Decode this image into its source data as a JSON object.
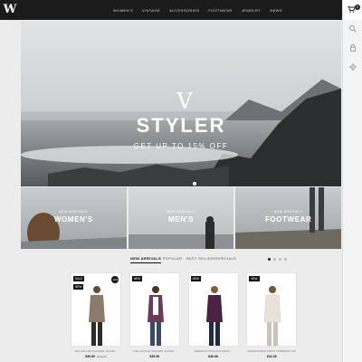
{
  "brand": {
    "logo_text": "W"
  },
  "nav": {
    "items": [
      "Women's",
      "Vintage",
      "Accessories",
      "Footwear",
      "Jewelry",
      "News"
    ]
  },
  "sidebar": {
    "cart_count": "0",
    "icons": [
      "cart-icon",
      "search-icon",
      "user-icon",
      "gear-icon"
    ]
  },
  "hero": {
    "mark": "V",
    "title": "STYLER",
    "subtitle": "GET UP TO 15% OFF"
  },
  "categories": [
    {
      "kicker": "NEW ARRIVALS",
      "label": "WOMEN'S"
    },
    {
      "kicker": "NEW ARRIVALS",
      "label": "MEN'S"
    },
    {
      "kicker": "NEW ARRIVALS",
      "label": "FOOTWEAR"
    }
  ],
  "tabs": [
    "New Arrivals",
    "Popular",
    "Best Sellers",
    "Specials"
  ],
  "pager": {
    "active": 1,
    "count": 4
  },
  "products": [
    {
      "badge_new": "NEW",
      "badge_sale": "SALE",
      "badge_pct": "-10%",
      "name": "TAN COLLAR LEATHER JACKET...",
      "price": "$39.80",
      "old_price": "$44.00",
      "color": "#8a7a6a"
    },
    {
      "badge_new": "NEW",
      "name": "THE COLLAR LEATHER JACKET...",
      "price": "$35.96",
      "color": "#6a3a5a"
    },
    {
      "badge_new": "NEW",
      "name": "DENIM FIT WITH POCKETS...",
      "price": "$45.96",
      "color": "#4a2242"
    },
    {
      "badge_new": "NEW",
      "name": "FASHIONABLE PRINT TRIMMING TOP",
      "price": "$32.28",
      "color": "#e8e2d8"
    }
  ],
  "colors": {
    "topbar": "#1b1b1b",
    "accent": "#111111"
  }
}
